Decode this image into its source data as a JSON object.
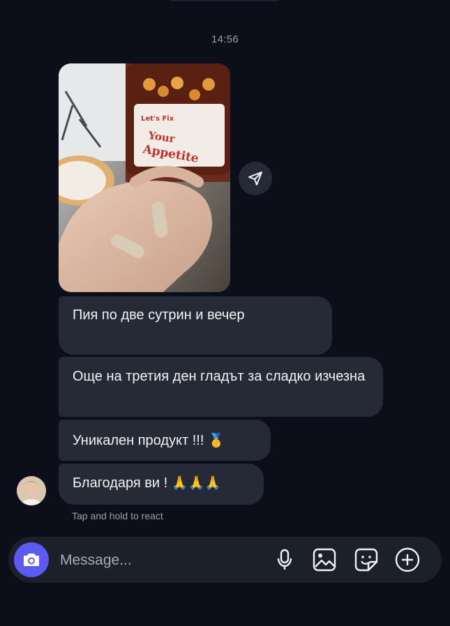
{
  "header": {
    "timestamp": "14:56"
  },
  "photo": {
    "label_brand": "Let's Fix",
    "label_title_1": "Your",
    "label_title_2": "Appetite",
    "icon": "share-icon"
  },
  "messages": [
    {
      "text": "Пия по две сутрин и вечер"
    },
    {
      "text": "Още на третия ден гладът за сладко изчезна"
    },
    {
      "text": "Уникален продукт !!!",
      "emoji": "🥇"
    },
    {
      "text": "Благодаря ви !",
      "emoji": "🙏🙏🙏"
    }
  ],
  "hint": {
    "react": "Tap and hold to react"
  },
  "composer": {
    "placeholder": "Message...",
    "icons": [
      "camera-icon",
      "microphone-icon",
      "gallery-icon",
      "sticker-icon",
      "plus-icon"
    ]
  },
  "colors": {
    "background": "#0c0f1a",
    "bubble": "#262a36",
    "accent": "#5b5bf2"
  }
}
